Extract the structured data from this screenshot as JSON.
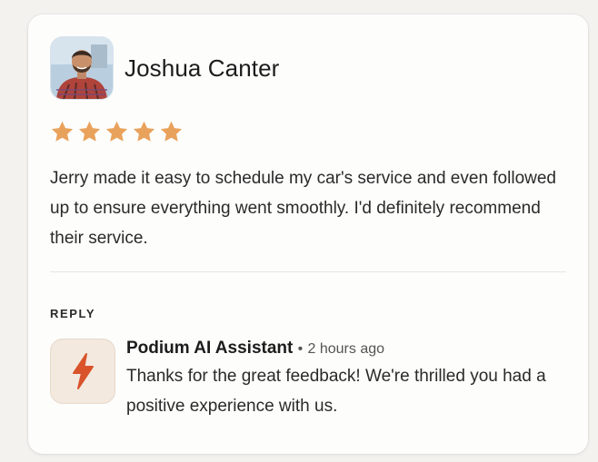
{
  "review": {
    "reviewer_name": "Joshua Canter",
    "rating": 5,
    "rating_max": 5,
    "text": "Jerry made it easy to schedule my car's service and even followed up to ensure everything went smoothly. I'd definitely recommend their service."
  },
  "reply": {
    "label": "REPLY",
    "author": "Podium AI Assistant",
    "separator": "•",
    "time": "2 hours ago",
    "text": "Thanks for the great feedback! We're thrilled you had a positive experience with us."
  },
  "icons": {
    "avatar": "avatar-photo",
    "star": "star-icon",
    "ai": "lightning-bolt-icon"
  },
  "colors": {
    "star": "#E9A25C",
    "bolt": "#D9542B",
    "ai_icon_bg": "#F3E9DF",
    "card_bg": "#FDFDFC"
  }
}
